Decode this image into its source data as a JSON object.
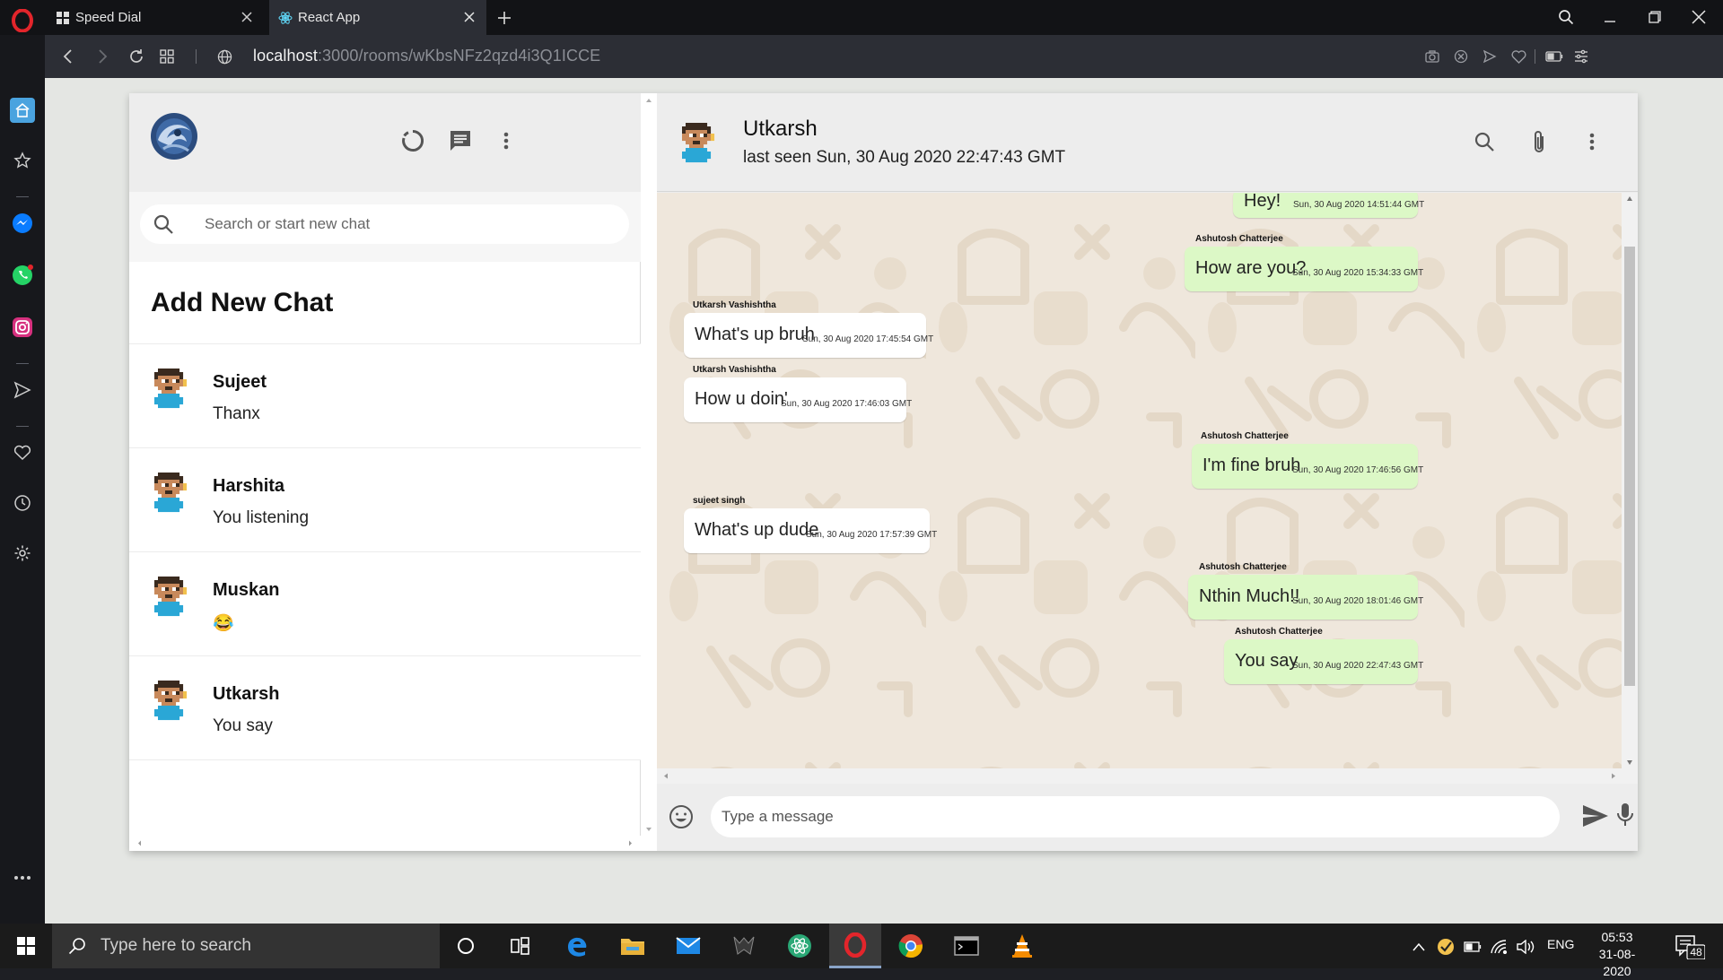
{
  "browser": {
    "tabs": [
      {
        "title": "Speed Dial",
        "icon": "speed-dial-grid-icon",
        "active": false
      },
      {
        "title": "React App",
        "icon": "react-icon",
        "active": true
      }
    ],
    "url_host": "localhost",
    "url_path": ":3000/rooms/wKbsNFz2qzd4i3Q1ICCE"
  },
  "sidebar_left": {
    "title": "",
    "search_placeholder": "Search or start new chat",
    "add_new_chat": "Add New Chat",
    "chats": [
      {
        "name": "Sujeet",
        "last_message": "Thanx"
      },
      {
        "name": "Harshita",
        "last_message": "You listening"
      },
      {
        "name": "Muskan",
        "last_message": "😂"
      },
      {
        "name": "Utkarsh",
        "last_message": "You say"
      }
    ]
  },
  "chat_header": {
    "name": "Utkarsh",
    "last_seen": "last seen Sun, 30 Aug 2020 22:47:43 GMT"
  },
  "messages": [
    {
      "sender": "",
      "text": "Hey!",
      "timestamp": "Sun, 30 Aug 2020 14:51:44 GMT",
      "mine": true
    },
    {
      "sender": "Ashutosh Chatterjee",
      "text": "How are you?",
      "timestamp": "Sun, 30 Aug 2020 15:34:33 GMT",
      "mine": true
    },
    {
      "sender": "Utkarsh Vashishtha",
      "text": "What's up bruh",
      "timestamp": "Sun, 30 Aug 2020 17:45:54 GMT",
      "mine": false
    },
    {
      "sender": "Utkarsh Vashishtha",
      "text": "How u doin'",
      "timestamp": "Sun, 30 Aug 2020 17:46:03 GMT",
      "mine": false
    },
    {
      "sender": "Ashutosh Chatterjee",
      "text": "I'm fine bruh",
      "timestamp": "Sun, 30 Aug 2020 17:46:56 GMT",
      "mine": true
    },
    {
      "sender": "sujeet singh",
      "text": "What's up dude",
      "timestamp": "Sun, 30 Aug 2020 17:57:39 GMT",
      "mine": false
    },
    {
      "sender": "Ashutosh Chatterjee",
      "text": "Nthin Much!!",
      "timestamp": "Sun, 30 Aug 2020 18:01:46 GMT",
      "mine": true
    },
    {
      "sender": "Ashutosh Chatterjee",
      "text": "You say",
      "timestamp": "Sun, 30 Aug 2020 22:47:43 GMT",
      "mine": true
    }
  ],
  "composer": {
    "placeholder": "Type a message"
  },
  "taskbar": {
    "search_placeholder": "Type here to search",
    "language": "ENG",
    "time": "05:53",
    "date": "31-08-2020",
    "notification_count": "48"
  },
  "colors": {
    "sent_bubble": "#dcf8c6",
    "received_bubble": "#ffffff",
    "chat_background": "#efe7dc",
    "header_background": "#ededed"
  }
}
